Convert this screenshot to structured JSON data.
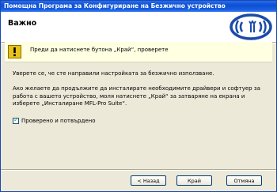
{
  "window": {
    "title": "Помощна Програма за Конфигуриране на Безжично устройство"
  },
  "header": {
    "title": "Важно",
    "logo_icon": "wireless-logo-icon"
  },
  "notice": {
    "icon": "warning-icon",
    "text": "Преди да натиснете бутона „Край“, проверете"
  },
  "body": {
    "paragraph1": "Уверете се, че сте направили настройката за безжично използване.",
    "paragraph2": "Ако желаете да продължите да инсталирате необходимите драйвери и софтуер за работа с вашето устройство, моля натиснете „Край“ за затваряне на екрана и изберете „Инсталиране MFL-Pro Suite“."
  },
  "confirm_checkbox": {
    "label": "Проверено и потвърдено",
    "checked": true
  },
  "buttons": {
    "back": "< Назад",
    "finish": "Край",
    "cancel": "Отмяна"
  },
  "colors": {
    "title_bar": "#0a4fd4",
    "logo_blue": "#1b4ba8",
    "notice_bg": "#ffffe1",
    "window_bg": "#ece9d8"
  }
}
